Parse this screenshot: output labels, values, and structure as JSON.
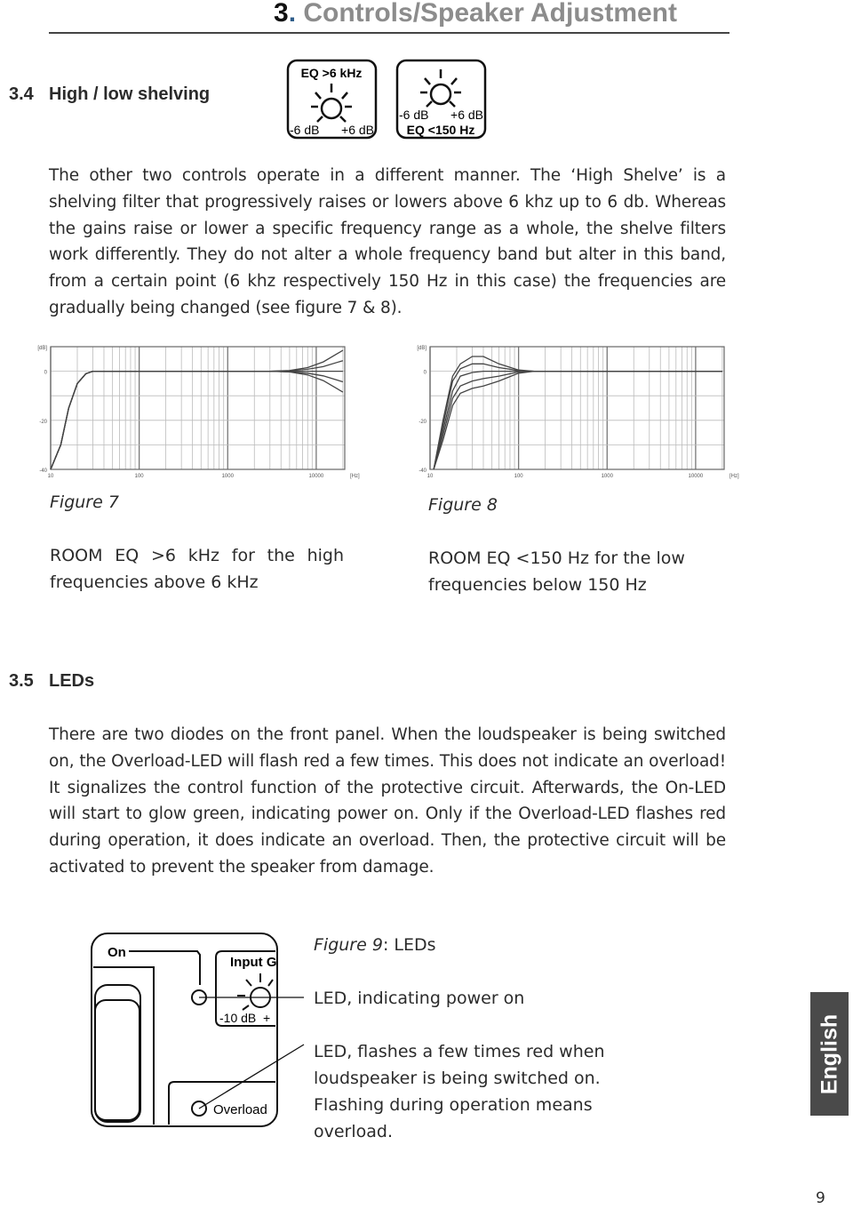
{
  "header": {
    "number": "3",
    "dot": ".",
    "title": " Controls/Speaker Adjustment"
  },
  "section_34": {
    "number": "3.4",
    "title": "High / low shelving",
    "knob_high": {
      "label": "EQ >6 kHz",
      "min": "-6 dB",
      "max": "+6 dB",
      "icon": "knob-icon"
    },
    "knob_low": {
      "label": "EQ <150 Hz",
      "min": "-6 dB",
      "max": "+6 dB",
      "icon": "knob-icon"
    },
    "paragraph": "The other two controls operate in a different manner. The ‘High Shelve’ is a shelving filter that progressively raises or lowers above 6 khz up to 6 db. Whereas the gains raise or lower a specific frequency range as a whole, the shelve filters work differently. They do not alter a whole frequency band but alter in this band, from a certain point (6 khz respectively 150 Hz in this case) the frequencies are gradually being changed (see figure 7 & 8)."
  },
  "figure7": {
    "label": "Figure 7",
    "caption": "ROOM EQ >6 kHz for the high frequencies above 6 kHz"
  },
  "figure8": {
    "label": "Figure 8",
    "caption": "ROOM EQ <150 Hz for the low frequencies below 150 Hz"
  },
  "chart_data": [
    {
      "type": "line",
      "ylabel": "[dB]",
      "xlabel": "[Hz]",
      "x_scale": "log",
      "xlim": [
        10,
        21000
      ],
      "ylim": [
        -40,
        10
      ],
      "grid": true,
      "yticks": [
        "0",
        "-20",
        "-40"
      ],
      "xticks": [
        {
          "v": 10,
          "label": "10"
        },
        {
          "v": 100,
          "label": "100"
        },
        {
          "v": 1000,
          "label": "1000"
        },
        {
          "v": 10000,
          "label": "10000"
        }
      ],
      "x": [
        10,
        13,
        16,
        20,
        25,
        30,
        100,
        1000,
        3000,
        5000,
        8000,
        12000,
        20000
      ],
      "series": [
        {
          "values": [
            -40,
            -30,
            -15,
            -5,
            -1,
            0,
            0,
            0,
            0,
            0.3,
            1.5,
            3.8,
            8.5
          ]
        },
        {
          "values": [
            -40,
            -30,
            -15,
            -5,
            -1,
            0,
            0,
            0,
            0,
            0.2,
            0.8,
            1.9,
            4.3
          ]
        },
        {
          "values": [
            -40,
            -30,
            -15,
            -5,
            -1,
            0,
            0,
            0,
            0,
            0,
            0,
            0,
            0
          ]
        },
        {
          "values": [
            -40,
            -30,
            -15,
            -5,
            -1,
            0,
            0,
            0,
            0,
            -0.2,
            -0.8,
            -1.9,
            -4.3
          ]
        },
        {
          "values": [
            -40,
            -30,
            -15,
            -5,
            -1,
            0,
            0,
            0,
            0,
            -0.3,
            -1.5,
            -3.8,
            -8.5
          ]
        }
      ]
    },
    {
      "type": "line",
      "ylabel": "[dB]",
      "xlabel": "[Hz]",
      "x_scale": "log",
      "xlim": [
        10,
        21000
      ],
      "ylim": [
        -40,
        10
      ],
      "grid": true,
      "yticks": [
        "0",
        "-20",
        "-40"
      ],
      "xticks": [
        {
          "v": 10,
          "label": "10"
        },
        {
          "v": 100,
          "label": "100"
        },
        {
          "v": 1000,
          "label": "1000"
        },
        {
          "v": 10000,
          "label": "10000"
        }
      ],
      "x": [
        11,
        14,
        18,
        22,
        30,
        40,
        60,
        100,
        150,
        1000,
        20000
      ],
      "series": [
        {
          "values": [
            -40,
            -20,
            -2,
            3,
            6,
            6,
            3,
            0.5,
            0,
            0,
            0
          ]
        },
        {
          "values": [
            -40,
            -22,
            -4,
            1,
            3,
            3,
            1.5,
            0.3,
            0,
            0,
            0
          ]
        },
        {
          "values": [
            -40,
            -24,
            -8,
            -2,
            -0.5,
            0,
            0,
            0,
            0,
            0,
            0
          ]
        },
        {
          "values": [
            -40,
            -26,
            -11,
            -6,
            -4,
            -3,
            -2,
            -0.3,
            0,
            0,
            0
          ]
        },
        {
          "values": [
            -40,
            -28,
            -14,
            -9,
            -7,
            -6,
            -4,
            -0.8,
            0,
            0,
            0
          ]
        }
      ]
    }
  ],
  "section_35": {
    "number": "3.5",
    "title": "LEDs",
    "paragraph": "There are two diodes on the front panel. When the loudspeaker is being switched on, the Overload-LED will flash red a few times. This does not indicate an overload! It signalizes the control function of the protective circuit. Afterwards, the On-LED will start to glow green, indicating power on. Only if the Overload-LED flashes red during operation, it does indicate an overload. Then, the protective circuit will be activated to prevent the speaker from damage."
  },
  "figure9": {
    "label": "Figure 9",
    "label_suffix": ": LEDs",
    "panel": {
      "on": "On",
      "input": "Input G",
      "scale": "-10 dB  +",
      "overload": "Overload"
    },
    "callout_on": "LED, indicating power on",
    "callout_overload": "LED, flashes a few times red when loudspeaker is being switched on. Flashing during operation means overload."
  },
  "side_tab": "English",
  "page_number": "9"
}
